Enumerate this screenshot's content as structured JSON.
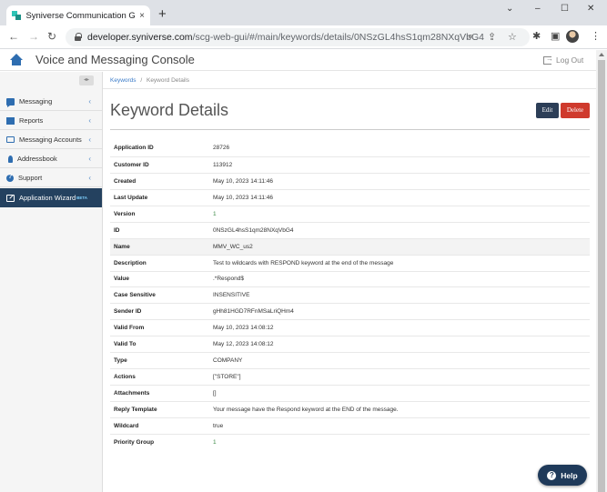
{
  "browser": {
    "tab_title": "Syniverse Communication Gatew",
    "tab_close": "×",
    "new_tab": "+",
    "url_domain": "developer.syniverse.com",
    "url_path": "/scg-web-gui/#/main/keywords/details/0NSzGL4hsS1qm28NXqVbG4",
    "window_controls": [
      "⌄",
      "–",
      "☐",
      "✕"
    ]
  },
  "app": {
    "title": "Voice and Messaging Console",
    "logout_label": "Log Out"
  },
  "sidebar": {
    "collapse_glyph": "◂▸",
    "items": [
      {
        "label": "Messaging",
        "icon": "message-icon"
      },
      {
        "label": "Reports",
        "icon": "reports-icon"
      },
      {
        "label": "Messaging Accounts",
        "icon": "monitor-icon"
      },
      {
        "label": "Addressbook",
        "icon": "addressbook-icon"
      },
      {
        "label": "Support",
        "icon": "help-circle-icon"
      },
      {
        "label": "Application Wizard",
        "badge": "BETA",
        "icon": "wizard-icon",
        "active": true
      }
    ]
  },
  "breadcrumb": {
    "link": "Keywords",
    "separator": "/",
    "current": "Keyword Details"
  },
  "page": {
    "title": "Keyword Details",
    "edit_label": "Edit",
    "delete_label": "Delete"
  },
  "details": [
    {
      "key": "Application ID",
      "value": "28726"
    },
    {
      "key": "Customer ID",
      "value": "113912"
    },
    {
      "key": "Created",
      "value": "May 10, 2023 14:11:46"
    },
    {
      "key": "Last Update",
      "value": "May 10, 2023 14:11:46"
    },
    {
      "key": "Version",
      "value": "1"
    },
    {
      "key": "ID",
      "value": "0NSzGL4hsS1qm28NXqVbG4"
    },
    {
      "key": "Name",
      "value": "MMV_WC_us2"
    },
    {
      "key": "Description",
      "value": "Test to wildcards with RESPOND keyword at the end of the message"
    },
    {
      "key": "Value",
      "value": ".*Respond$"
    },
    {
      "key": "Case Sensitive",
      "value": "INSENSITIVE"
    },
    {
      "key": "Sender ID",
      "value": "gHh81HGD7RFnMSaLriQHm4"
    },
    {
      "key": "Valid From",
      "value": "May 10, 2023 14:08:12"
    },
    {
      "key": "Valid To",
      "value": "May 12, 2023 14:08:12"
    },
    {
      "key": "Type",
      "value": "COMPANY"
    },
    {
      "key": "Actions",
      "value": "[\"STORE\"]"
    },
    {
      "key": "Attachments",
      "value": "[]"
    },
    {
      "key": "Reply Template",
      "value": "Your message have the Respond keyword at the END of the message."
    },
    {
      "key": "Wildcard",
      "value": "true"
    },
    {
      "key": "Priority Group",
      "value": "1"
    }
  ],
  "help": {
    "label": "Help",
    "icon_glyph": "?"
  },
  "colors": {
    "sidebar_active": "#24415f",
    "edit_button": "#2c3e57",
    "delete_button": "#cf3a2d",
    "link": "#3a7bc8",
    "numeric_value": "#3d8a48"
  }
}
